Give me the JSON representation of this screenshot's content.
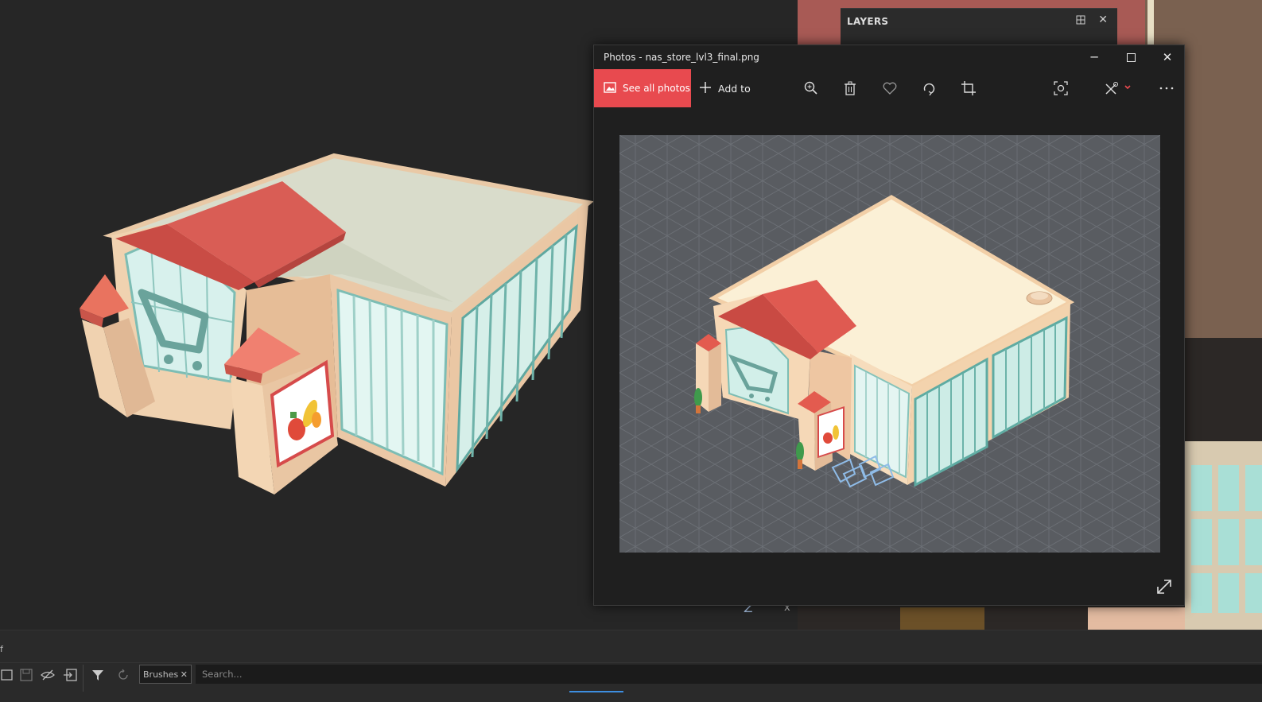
{
  "layers_panel": {
    "title": "LAYERS"
  },
  "photos_window": {
    "title": "Photos - nas_store_lvl3_final.png",
    "see_all_label": "See all photos",
    "add_to_label": "Add to"
  },
  "viewport": {
    "axis_z": "Z",
    "axis_x": "x"
  },
  "bottom_panel": {
    "fragment_label": "f",
    "tab_label": "Brushes",
    "search_placeholder": "Search..."
  },
  "colors": {
    "accent": "#e84a4f",
    "roof_red": "#e0564e",
    "wall_peach": "#f1cfa8",
    "glass": "#c9ece6"
  }
}
